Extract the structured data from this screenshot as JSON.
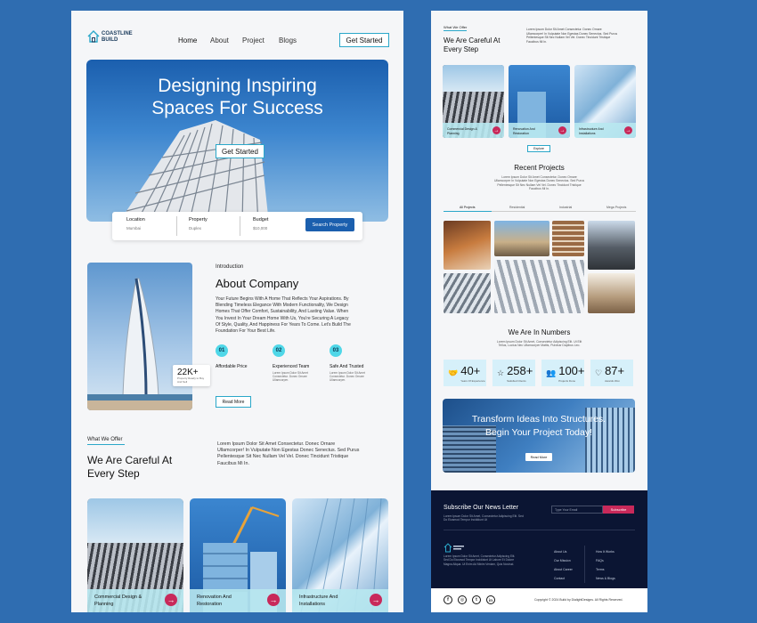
{
  "brand": {
    "logo_line1": "COASTLINE",
    "logo_line2": "BUILD"
  },
  "nav": {
    "items": [
      "Home",
      "About",
      "Project",
      "Blogs"
    ],
    "cta": "Get Started"
  },
  "hero": {
    "title_line1": "Designing Inspiring",
    "title_line2": "Spaces For Success",
    "cta": "Get Started"
  },
  "search": {
    "fields": [
      {
        "label": "Location",
        "value": "Mumbai"
      },
      {
        "label": "Property",
        "value": "Duplex"
      },
      {
        "label": "Budget",
        "value": "$10,000"
      }
    ],
    "button": "Search Property"
  },
  "about": {
    "eyebrow": "Introduction",
    "title": "About Company",
    "body": [
      "Your Future Begins With A Home That Reflects Your Aspirations. By",
      "Blending Timeless Elegance With Modern Functionality, We Design",
      "Homes That Offer Comfort, Sustainability, And Lasting Value. When",
      "You Invest In Your Dream Home With Us, You're Securing A Legacy",
      "Of Style, Quality, And Happiness For Years To Come. Let's Build The",
      "Foundation For Your Best Life."
    ],
    "stat_value": "22K+",
    "stat_label": "Property Ready to Buy And Sell",
    "features": [
      {
        "num": "01",
        "title": "Affordable Price",
        "desc": ""
      },
      {
        "num": "02",
        "title": "Experienced Team",
        "desc": "Lorem Ipsum Dolor Sit Amet Consectetur. Donec Ornare Ullamcorper."
      },
      {
        "num": "03",
        "title": "Safe And Trusted",
        "desc": "Lorem Ipsum Dolor Sit Amet Consectetur. Donec Ornare Ullamcorper."
      }
    ],
    "cta": "Read More"
  },
  "offer": {
    "eyebrow": "What We Offer",
    "title_line1": "We Are Careful At",
    "title_line2": "Every Step",
    "desc": [
      "Lorem Ipsum Dolor Sit Amet Consectetur. Donec Ornare",
      "Ullamcorper! In Vulputate Non Egestas Donec Senectus. Sed Purus",
      "Pellentesque Sit Nec Nullam Vel Vel. Donec Tincidunt Tristique",
      "Faucibus Mi In."
    ],
    "cards": [
      {
        "line1": "Commercial Design &",
        "line2": "Planning"
      },
      {
        "line1": "Renovation And",
        "line2": "Restoration"
      },
      {
        "line1": "Infrastructure And",
        "line2": "Installations"
      }
    ],
    "explore": "Explore"
  },
  "projects": {
    "title": "Recent Projects",
    "desc": [
      "Lorem Ipsum Dolor Sit Amet Consectetur. Donec Ornare",
      "Ullamcorper In Vulputate Non Egestas Donec Senectus. Sed Purus",
      "Pellentesque Sit Nec Nullam Vel Vel. Donec Tincidunt Tristique",
      "Faucibus Mi In."
    ],
    "tabs": [
      "All Projects",
      "Residential",
      "Industrial",
      "Mega Projects"
    ]
  },
  "numbers": {
    "title": "We Are In Numbers",
    "desc": [
      "Lorem Ipsum Dolor Sit Amet, Consectetur Adipiscing Elit. Ut Elit",
      "Tellus, Luctus Nec Ullamcorper Mattis, Pulvinar Dapibus Leo."
    ],
    "stats": [
      {
        "value": "40+",
        "label": "Years Of Experience",
        "icon": "handshake-icon"
      },
      {
        "value": "258+",
        "label": "Satisfied Clients",
        "icon": "star-icon"
      },
      {
        "value": "100+",
        "label": "Projects Done",
        "icon": "team-icon"
      },
      {
        "value": "87+",
        "label": "Awards Won",
        "icon": "heart-icon"
      }
    ]
  },
  "banner": {
    "line1": "Transform Ideas Into Structures.",
    "line2": "Begin Your Project Today!",
    "cta": "Read More"
  },
  "footer": {
    "subscribe_title": "Subscribe Our News Letter",
    "subscribe_desc": [
      "Lorem Ipsum Dolor Sit Amet, Consectetur Adipiscing Elit. Sed",
      "Do Eiusmod Tempor Incididunt Ut"
    ],
    "email_placeholder": "Type Your Email",
    "subscribe_btn": "Subscribe",
    "about_text": [
      "Lorem Ipsum Dolor Sit Amet, Consectetur Adipiscing Elit.",
      "Sed Do Eiusmod Tempor Incididunt Ut Labore Et Dolore",
      "Magna Aliqua. Ut Enim Ad Minim Veniam, Quis Nostrud."
    ],
    "col1": [
      "About Us",
      "Our Mission",
      "About Career",
      "Contact"
    ],
    "col2": [
      "How It Works",
      "FAQs",
      "Terms",
      "News & Blogs"
    ],
    "copyright": "Copyright © 2024 Build by DialightDesigns. All Rights Reserved."
  },
  "colors": {
    "accent": "#2aa7c9",
    "cta_blue": "#1b5fae",
    "pink": "#c8295a",
    "footer_bg": "#0b1533",
    "page_bg": "#2f6db1"
  }
}
